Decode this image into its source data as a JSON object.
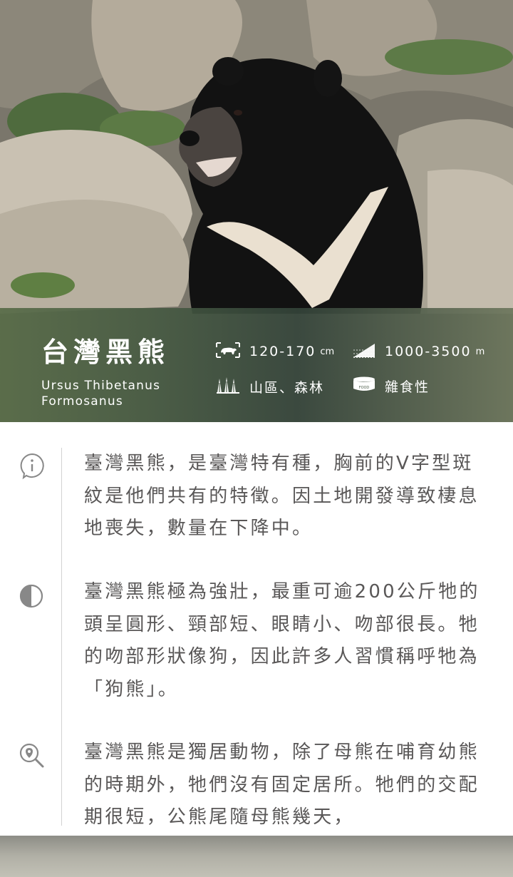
{
  "hero": {
    "image_alt": "台灣黑熊"
  },
  "species": {
    "title": "台灣黑熊",
    "latin": "Ursus Thibetanus Formosanus"
  },
  "facts": {
    "size": {
      "value": "120-170",
      "unit": "cm",
      "icon": "bear-size-icon"
    },
    "altitude": {
      "value": "1000-3500",
      "unit": "m",
      "icon": "altitude-slope-icon"
    },
    "habitat": {
      "value": "山區、森林",
      "icon": "forest-icon"
    },
    "diet": {
      "value": "雜食性",
      "icon": "food-bowl-icon",
      "icon_text": "FOOD"
    }
  },
  "sections": [
    {
      "icon": "info-icon",
      "text": "臺灣黑熊，是臺灣特有種，胸前的V字型斑紋是他們共有的特徵。因土地開發導致棲息地喪失，數量在下降中。"
    },
    {
      "icon": "half-circle-icon",
      "text": "臺灣黑熊極為強壯，最重可逾200公斤牠的頭呈圓形、頸部短、眼睛小、吻部很長。牠的吻部形狀像狗，因此許多人習慣稱呼牠為「狗熊」。"
    },
    {
      "icon": "location-search-icon",
      "text": "臺灣黑熊是獨居動物，除了母熊在哺育幼熊的時期外，牠們沒有固定居所。牠們的交配期很短，公熊尾隨母熊幾天，"
    }
  ],
  "colors": {
    "text": "#595757",
    "band": "#4b5c48",
    "rail": "#d2d2d2"
  }
}
